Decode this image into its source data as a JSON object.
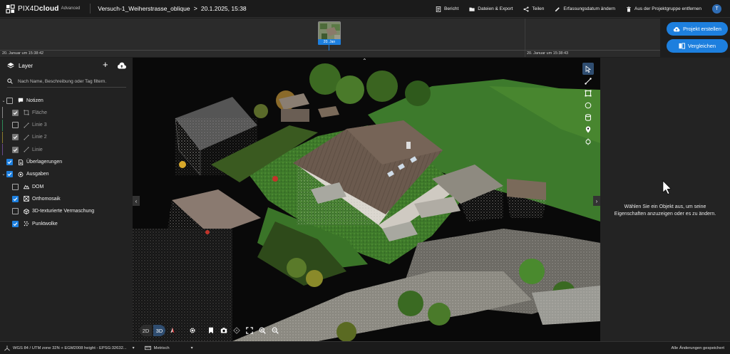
{
  "app": {
    "name_prefix": "PIX4D",
    "name_bold": "cloud",
    "edition": "Advanced",
    "project_title": "Versuch-1_Weiherstrasse_oblique",
    "breadcrumb_separator": ">",
    "project_date": "20.1.2025, 15:38"
  },
  "header_actions": [
    {
      "label": "Bericht",
      "icon": "report-icon"
    },
    {
      "label": "Dateien & Export",
      "icon": "folder-icon"
    },
    {
      "label": "Teilen",
      "icon": "share-icon"
    },
    {
      "label": "Erfassungsdatum ändern",
      "icon": "pencil-icon"
    },
    {
      "label": "Aus der Projektgruppe entfernen",
      "icon": "trash-icon"
    }
  ],
  "user_avatar": "T",
  "timeline": {
    "chip_label": "20. Jan",
    "start_label": "20. Januar um 15:38:42",
    "end_label": "20. Januar um 15:38:43"
  },
  "right_actions": {
    "create_label": "Projekt erstellen",
    "compare_label": "Vergleichen"
  },
  "layers": {
    "title": "Layer",
    "add_symbol": "+",
    "search_placeholder": "Nach Name, Beschreibung oder Tag filtern.",
    "items": [
      {
        "label": "Notizen",
        "level": 0,
        "caret": "v",
        "checkbox": "empty",
        "icon": "note-icon",
        "dim": false
      },
      {
        "label": "Fläche",
        "level": 1,
        "caret": "",
        "checkbox": "grey",
        "icon": "polygon-icon",
        "dim": true,
        "color": "#888888"
      },
      {
        "label": "Linie 3",
        "level": 1,
        "caret": "",
        "checkbox": "empty",
        "icon": "line-icon",
        "dim": true,
        "color": "#2e8b57"
      },
      {
        "label": "Linie 2",
        "level": 1,
        "caret": "",
        "checkbox": "grey",
        "icon": "line-icon",
        "dim": true,
        "color": "#8b7d2e"
      },
      {
        "label": "Linie",
        "level": 1,
        "caret": "",
        "checkbox": "grey",
        "icon": "line-icon",
        "dim": true,
        "color": "#6a4a8a"
      },
      {
        "label": "Überlagerungen",
        "level": 0,
        "caret": "",
        "checkbox": "checked",
        "icon": "document-icon",
        "dim": false
      },
      {
        "label": "Ausgaben",
        "level": 0,
        "caret": "v",
        "checkbox": "checked",
        "icon": "outputs-icon",
        "dim": false
      },
      {
        "label": "DOM",
        "level": 1,
        "caret": "",
        "checkbox": "empty",
        "icon": "dom-icon",
        "dim": false
      },
      {
        "label": "Orthomosaik",
        "level": 1,
        "caret": "",
        "checkbox": "checked",
        "icon": "orthomosaic-icon",
        "dim": false
      },
      {
        "label": "3D-texturierte Vermaschung",
        "level": 1,
        "caret": "",
        "checkbox": "empty",
        "icon": "mesh-icon",
        "dim": false
      },
      {
        "label": "Punktwolke",
        "level": 1,
        "caret": "",
        "checkbox": "checked",
        "icon": "pointcloud-icon",
        "dim": false
      }
    ]
  },
  "viewport": {
    "mode_2d": "2D",
    "mode_3d": "3D",
    "active_mode": "3D"
  },
  "right_panel": {
    "hint": "Wählen Sie ein Objekt aus, um seine Eigenschaften anzuzeigen oder es zu ändern."
  },
  "statusbar": {
    "crs": "WGS 84 / UTM zone 32N + EGM2008 height - EPSG:32632...",
    "units": "Metrisch",
    "save_status": "Alle Änderungen gespeichert"
  },
  "colors": {
    "accent": "#1d7fde",
    "active_tool": "#2f4d70"
  }
}
